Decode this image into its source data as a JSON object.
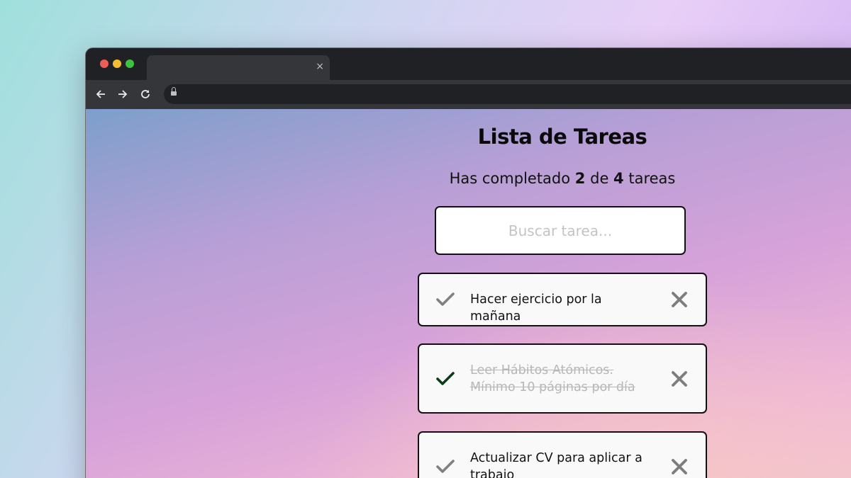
{
  "browser": {
    "tab_close": "×",
    "nav": {
      "back": "←",
      "forward": "→",
      "reload": "⟳"
    }
  },
  "app": {
    "title": "Lista de Tareas",
    "counter": {
      "prefix": "Has completado",
      "completed": "2",
      "middle": "de",
      "total": "4",
      "suffix": "tareas"
    },
    "search": {
      "placeholder": "Buscar tarea...",
      "value": ""
    },
    "tasks": [
      {
        "text": "Hacer ejercicio por la mañana",
        "completed": false
      },
      {
        "text": "Leer Hábitos Atómicos. Mínimo 10 páginas por día",
        "completed": true
      },
      {
        "text": "Actualizar CV para aplicar a trabajo",
        "completed": false
      }
    ],
    "colors": {
      "check_done": "#0b3d12",
      "check_pending": "#808080",
      "delete": "#7d7d7d"
    }
  }
}
